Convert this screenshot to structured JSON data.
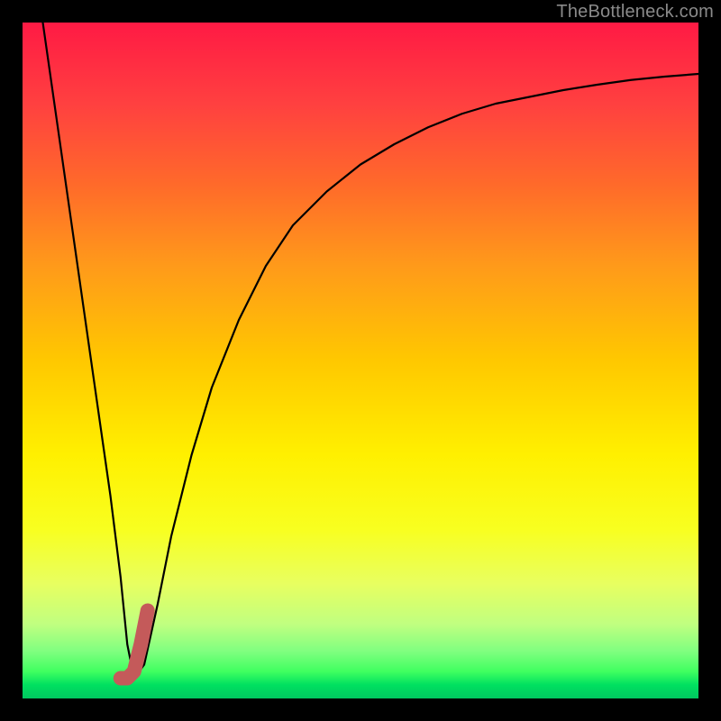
{
  "watermark": "TheBottleneck.com",
  "chart_data": {
    "type": "line",
    "title": "",
    "xlabel": "",
    "ylabel": "",
    "xlim": [
      0,
      100
    ],
    "ylim": [
      0,
      100
    ],
    "grid": false,
    "legend": false,
    "series": [
      {
        "name": "bottleneck-curve",
        "color": "#000000",
        "x": [
          3,
          5,
          7,
          9,
          11,
          13,
          14.5,
          15.5,
          16.5,
          18,
          20,
          22,
          25,
          28,
          32,
          36,
          40,
          45,
          50,
          55,
          60,
          65,
          70,
          75,
          80,
          85,
          90,
          95,
          100
        ],
        "y": [
          100,
          86,
          72,
          58,
          44,
          30,
          18,
          8,
          3,
          5,
          14,
          24,
          36,
          46,
          56,
          64,
          70,
          75,
          79,
          82,
          84.5,
          86.5,
          88,
          89,
          90,
          90.8,
          91.5,
          92,
          92.4
        ]
      },
      {
        "name": "highlight-segment",
        "color": "#c45a5a",
        "x": [
          14.5,
          15.5,
          16.5,
          17.5,
          18.5
        ],
        "y": [
          3,
          3,
          4,
          8,
          13
        ]
      }
    ],
    "background_gradient": {
      "top": "#ff1a44",
      "mid": "#fff000",
      "bottom": "#00c860"
    }
  }
}
